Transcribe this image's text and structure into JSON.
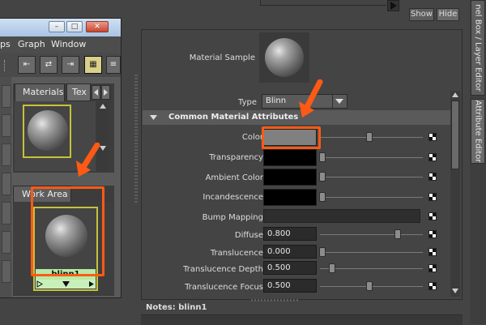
{
  "window": {
    "menus": [
      "ps",
      "Graph",
      "Window"
    ],
    "tabs": {
      "materials": "Materials",
      "textures": "Tex"
    },
    "work_area_tab": "Work Area",
    "node_name": "blinn1"
  },
  "attribute_editor": {
    "show_label": "Show",
    "hide_label": "Hide",
    "material_sample_label": "Material Sample",
    "type_label": "Type",
    "type_value": "Blinn",
    "section_title": "Common Material Attributes",
    "rows": [
      {
        "label": "Color",
        "kind": "color",
        "slider": 0.45
      },
      {
        "label": "Transparency",
        "kind": "black",
        "slider": 0.0
      },
      {
        "label": "Ambient Color",
        "kind": "black",
        "slider": 0.0
      },
      {
        "label": "Incandescence",
        "kind": "black",
        "slider": 0.0
      },
      {
        "label": "Bump Mapping",
        "kind": "bump"
      },
      {
        "label": "Diffuse",
        "kind": "number",
        "value": "0.800",
        "slider": 0.8
      },
      {
        "label": "Translucence",
        "kind": "number",
        "value": "0.000",
        "slider": 0.0
      },
      {
        "label": "Translucence Depth",
        "kind": "number",
        "value": "0.500",
        "slider": 0.1
      },
      {
        "label": "Translucence Focus",
        "kind": "number",
        "value": "0.500",
        "slider": 0.5
      }
    ],
    "notes_label": "Notes:",
    "notes_value": "blinn1"
  },
  "side_tabs": [
    "nel Box / Layer Editor",
    "Attribute Editor"
  ],
  "colors": {
    "annotation": "#ff5a14",
    "swatch_border": "#c6c23a",
    "color_swatch": "#808080"
  }
}
